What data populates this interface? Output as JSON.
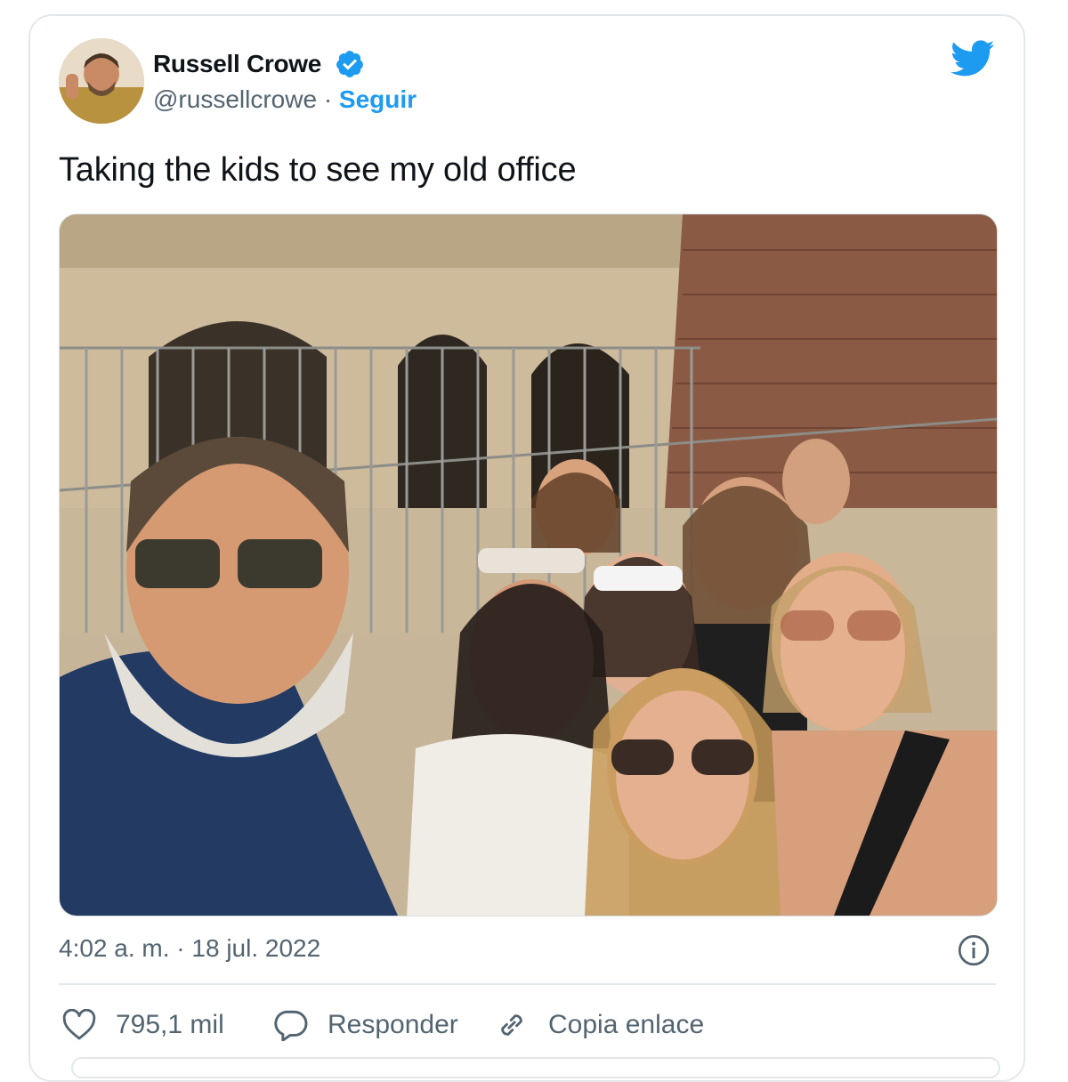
{
  "author": {
    "name": "Russell Crowe",
    "handle": "@russellcrowe",
    "separator": "·",
    "follow_label": "Seguir"
  },
  "tweet": {
    "text": "Taking the kids to see my old office",
    "timestamp": "4:02 a. m. · 18 jul. 2022"
  },
  "actions": {
    "likes": "795,1 mil",
    "reply_label": "Responder",
    "copy_link_label": "Copia enlace"
  },
  "icons": {
    "verified": "verified-badge-icon",
    "brand": "twitter-bird-icon",
    "info": "info-icon",
    "like": "heart-icon",
    "reply": "speech-bubble-icon",
    "link": "link-icon"
  },
  "colors": {
    "accent": "#1d9bf0",
    "text": "#0f1419",
    "secondary": "#536471",
    "border": "#e3e7ea"
  }
}
